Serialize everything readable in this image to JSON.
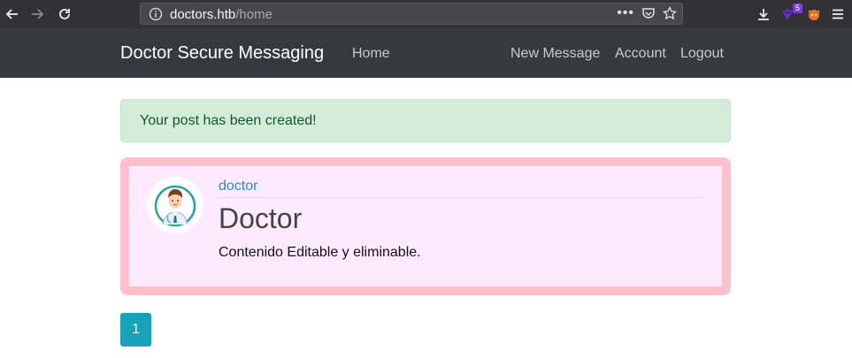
{
  "browser": {
    "url_host": "doctors.htb",
    "url_path": "/home",
    "extension_badge": "5"
  },
  "navbar": {
    "brand": "Doctor Secure Messaging",
    "home": "Home",
    "new_message": "New Message",
    "account": "Account",
    "logout": "Logout"
  },
  "alert": {
    "message": "Your post has been created!"
  },
  "post": {
    "author": "doctor",
    "title": "Doctor",
    "content": "Contenido Editable y eliminable."
  },
  "pagination": {
    "current_page": "1"
  },
  "colors": {
    "navbar_bg": "#343a40",
    "alert_bg": "#d4edda",
    "post_border": "#ffc0cb",
    "post_bg": "#fdeafe",
    "page_button": "#17a2b8"
  }
}
